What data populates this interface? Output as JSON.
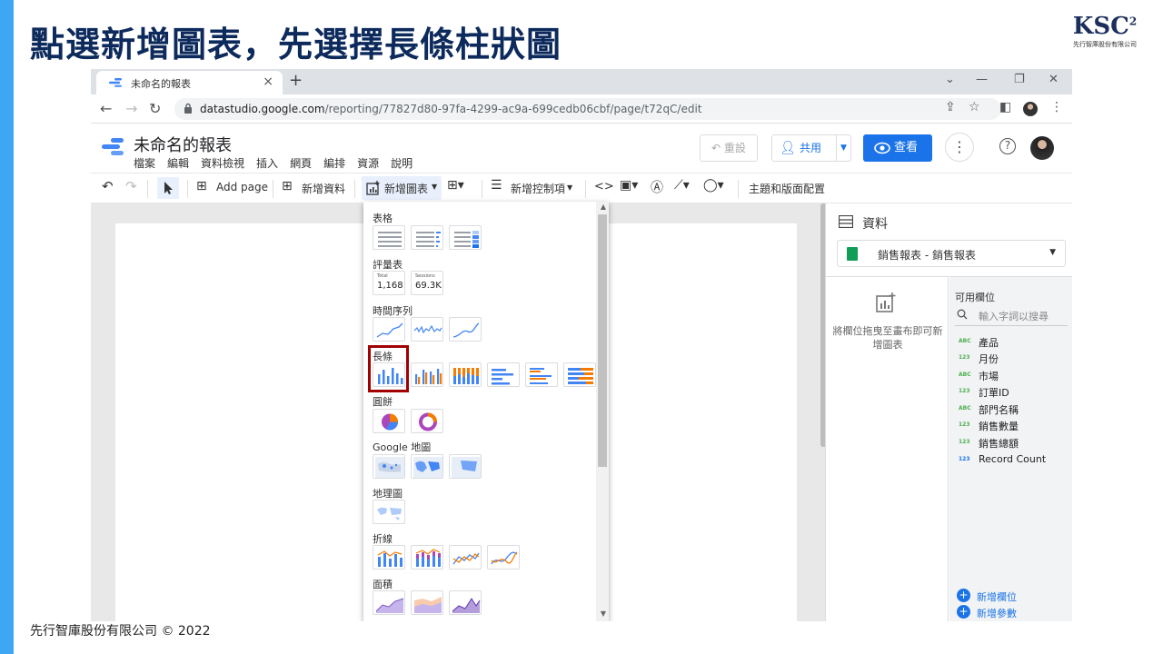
{
  "slide": {
    "title": "點選新增圖表，先選擇長條柱狀圖",
    "footer": "先行智庫股份有限公司 © 2022",
    "logo_mark": "KSC",
    "logo_sup": "2",
    "logo_sub": "先行智庫股份有限公司",
    "accent_color": "#3ea6f2",
    "title_color": "#0d2a5c"
  },
  "browser": {
    "tab_title": "未命名的報表",
    "tab_close": "×",
    "new_tab": "+",
    "url_host": "datastudio.google.com",
    "url_path": "/reporting/77827d80-97fa-4299-ac9a-699cedb06cbf/page/t72qC/edit"
  },
  "header": {
    "report_title": "未命名的報表",
    "menu": [
      "檔案",
      "編輯",
      "資料檢視",
      "插入",
      "網頁",
      "編排",
      "資源",
      "說明"
    ],
    "reset_label": "重設",
    "share_label": "共用",
    "view_label": "查看",
    "accent": "#1a73e8"
  },
  "toolbar": {
    "add_page": "Add page",
    "add_data": "新增資料",
    "add_chart": "新增圖表",
    "add_control": "新增控制項",
    "theme_layout": "主題和版面配置"
  },
  "chart_menu": {
    "groups": {
      "table": "表格",
      "scorecard": "評量表",
      "timeseries": "時間序列",
      "bar": "長條",
      "pie": "圓餅",
      "geo_google": "Google 地圖",
      "geo": "地理圖",
      "combo": "折線",
      "area": "面積"
    },
    "scorecard1_label": "Total",
    "scorecard1_value": "1,168",
    "scorecard2_label": "Sessions",
    "scorecard2_value": "69.3K",
    "highlight_color": "#a00000"
  },
  "data_panel": {
    "title": "資料",
    "source": "銷售報表 - 銷售報表",
    "drag_hint": "將欄位拖曳至畫布即可新增圖表",
    "available_fields": "可用欄位",
    "search_placeholder": "輸入字詞以搜尋",
    "fields": [
      {
        "type": "ABC",
        "name": "產品"
      },
      {
        "type": "123",
        "name": "月份"
      },
      {
        "type": "ABC",
        "name": "市場"
      },
      {
        "type": "123",
        "name": "訂單ID"
      },
      {
        "type": "ABC",
        "name": "部門名稱"
      },
      {
        "type": "123",
        "name": "銷售數量"
      },
      {
        "type": "123",
        "name": "銷售總額"
      },
      {
        "type": "123",
        "name": "Record Count"
      }
    ],
    "add_field": "新增欄位",
    "add_param": "新增參數"
  }
}
